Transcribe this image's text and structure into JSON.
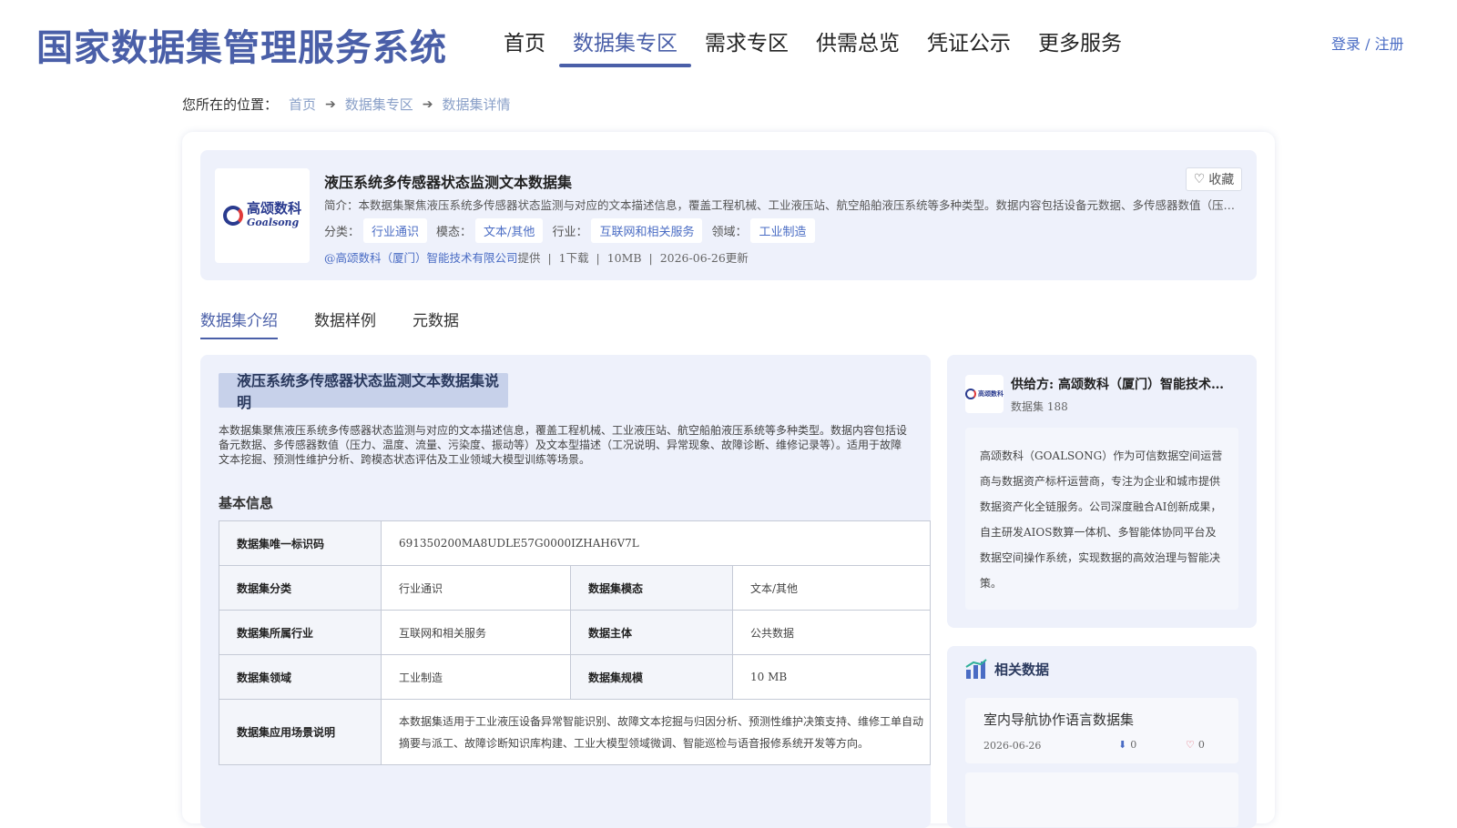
{
  "header": {
    "brand": "国家数据集管理服务系统",
    "nav": [
      "首页",
      "数据集专区",
      "需求专区",
      "供需总览",
      "凭证公示",
      "更多服务"
    ],
    "login": "登录 / 注册"
  },
  "breadcrumb": {
    "prefix": "您所在的位置：",
    "items": [
      "首页",
      "数据集专区",
      "数据集详情"
    ]
  },
  "dataset": {
    "logo_text": "高颂数科",
    "logo_sub": "Goalsong",
    "title": "液压系统多传感器状态监测文本数据集",
    "intro": "简介：本数据集聚焦液压系统多传感器状态监测与对应的文本描述信息，覆盖工程机械、工业液压站、航空船舶液压系统等多种类型。数据内容包括设备元数据、多传感器数值（压力、温度、流量、污染度、振动等）及文本型描述（工况说明、异常现象、故障诊断、维修记录等）。",
    "favorite": "收藏",
    "meta": [
      {
        "label": "分类：",
        "value": "行业通识"
      },
      {
        "label": "模态：",
        "value": "文本/其他"
      },
      {
        "label": "行业：",
        "value": "互联网和相关服务"
      },
      {
        "label": "领域：",
        "value": "工业制造"
      }
    ],
    "provider": "@高颂数科（厦门）智能技术有限公司",
    "provider_suffix": "提供",
    "downloads": "1下载",
    "size": "10MB",
    "updated": "2026-06-26更新"
  },
  "tabs": [
    "数据集介绍",
    "数据样例",
    "元数据"
  ],
  "content": {
    "section_title": "液压系统多传感器状态监测文本数据集说明",
    "description": "本数据集聚焦液压系统多传感器状态监测与对应的文本描述信息，覆盖工程机械、工业液压站、航空船舶液压系统等多种类型。数据内容包括设备元数据、多传感器数值（压力、温度、流量、污染度、振动等）及文本型描述（工况说明、异常现象、故障诊断、维修记录等）。适用于故障文本挖掘、预测性维护分析、跨模态状态评估及工业领域大模型训练等场景。",
    "basic_title": "基本信息",
    "table": {
      "uid_key": "数据集唯一标识码",
      "uid_val": "691350200MA8UDLE57G0000IZHAH6V7L",
      "category_key": "数据集分类",
      "category_val": "行业通识",
      "modality_key": "数据集模态",
      "modality_val": "文本/其他",
      "industry_key": "数据集所属行业",
      "industry_val": "互联网和相关服务",
      "subject_key": "数据主体",
      "subject_val": "公共数据",
      "domain_key": "数据集领域",
      "domain_val": "工业制造",
      "scale_key": "数据集规模",
      "scale_val": "10 MB",
      "scenario_key": "数据集应用场景说明",
      "scenario_val": "本数据集适用于工业液压设备异常智能识别、故障文本挖掘与归因分析、预测性维护决策支持、维修工单自动摘要与派工、故障诊断知识库构建、工业大模型领域微调、智能巡检与语音报修系统开发等方向。"
    }
  },
  "supplier": {
    "name": "供给方: 高颂数科（厦门）智能技术有限公司",
    "count": "数据集 188",
    "description": "高颂数科（GOALSONG）作为可信数据空间运营商与数据资产标杆运营商，专注为企业和城市提供数据资产化全链服务。公司深度融合AI创新成果，自主研发AIOS数算一体机、多智能体协同平台及数据空间操作系统，实现数据的高效治理与智能决策。"
  },
  "related": {
    "title": "相关数据",
    "items": [
      {
        "title": "室内导航协作语言数据集",
        "date": "2026-06-26",
        "downloads": "0",
        "likes": "0"
      }
    ]
  },
  "colors": {
    "brand": "#4a5fa8",
    "link": "#4a6cc4",
    "panel": "#eef1fb"
  }
}
